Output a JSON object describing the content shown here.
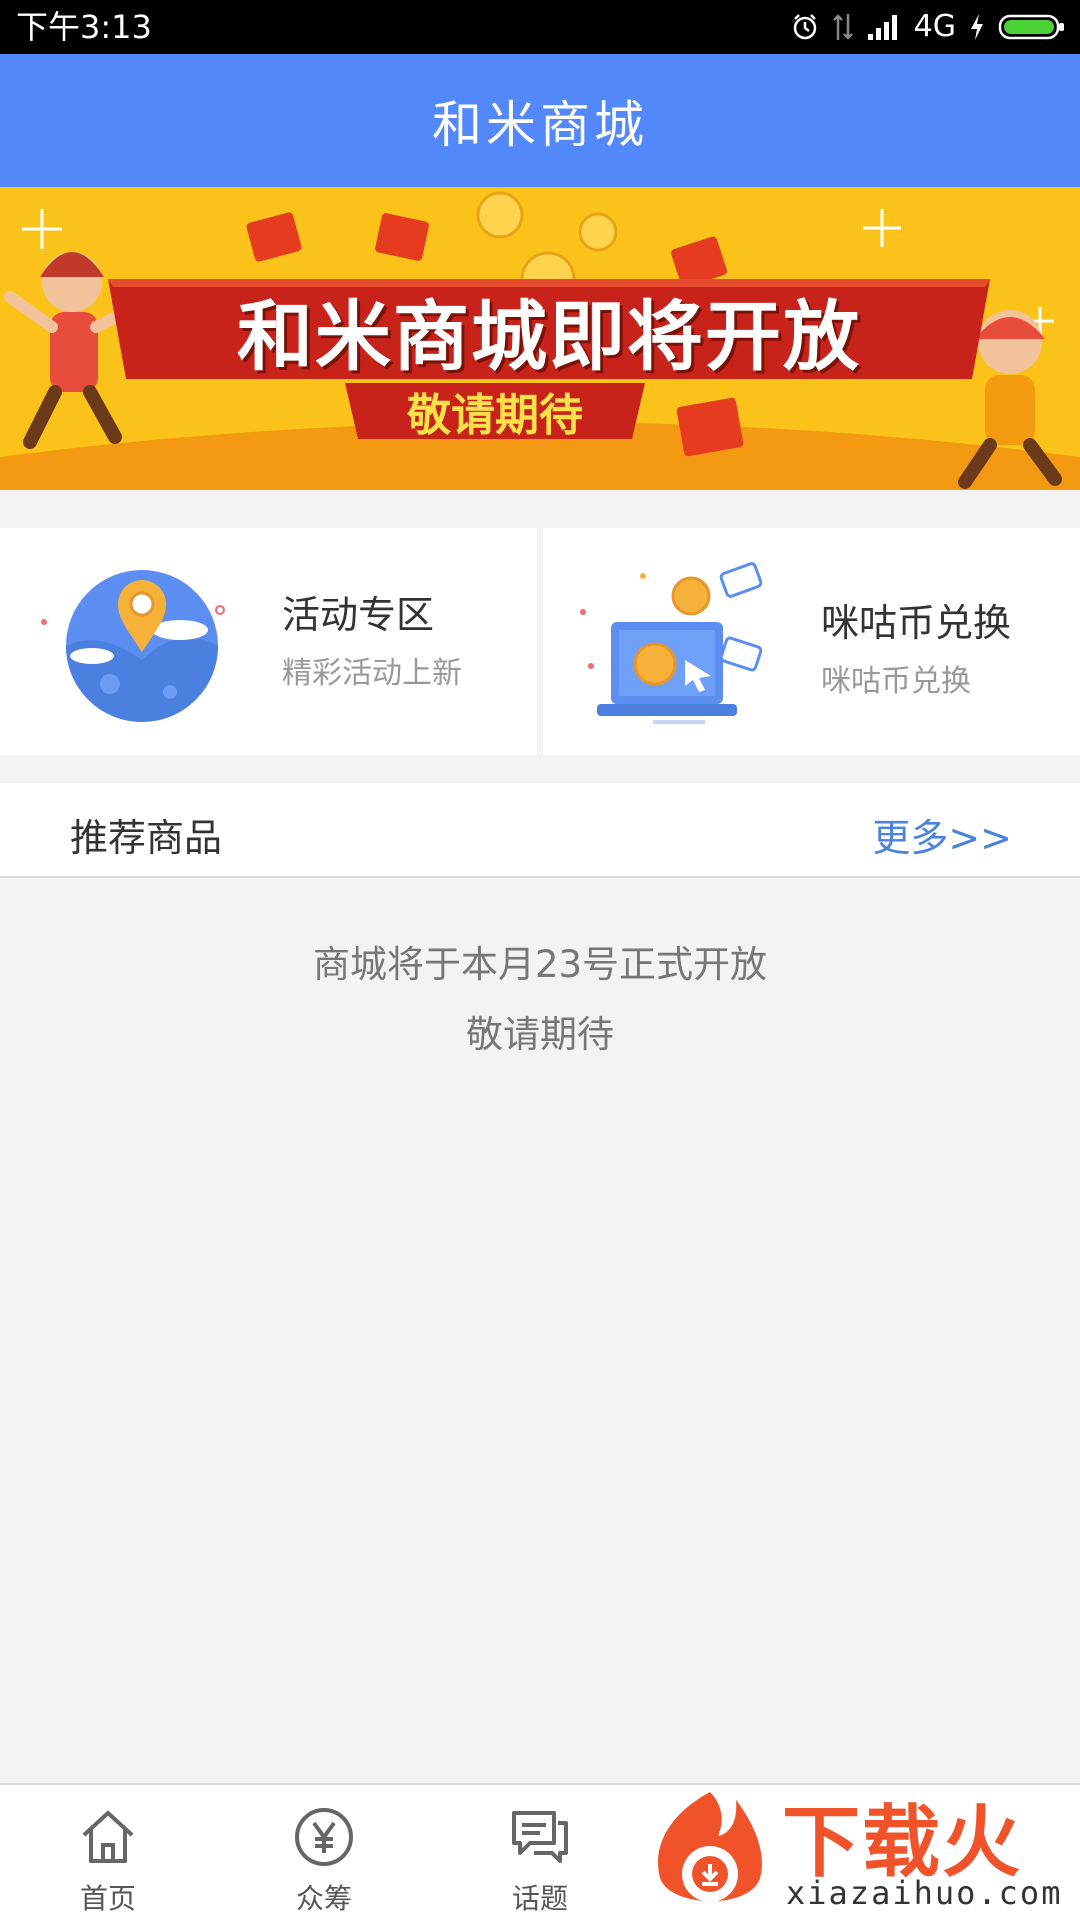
{
  "status_bar": {
    "time": "下午3:13",
    "network": "4G",
    "icons": [
      "alarm-icon",
      "data-arrows-icon",
      "signal-icon",
      "charging-icon",
      "battery-icon"
    ]
  },
  "header": {
    "title": "和米商城"
  },
  "banner": {
    "headline": "和米商城即将开放",
    "subline": "敬请期待"
  },
  "features": [
    {
      "title": "活动专区",
      "subtitle": "精彩活动上新",
      "icon": "location-pin-globe-icon"
    },
    {
      "title": "咪咕币兑换",
      "subtitle": "咪咕币兑换",
      "icon": "coin-exchange-icon"
    }
  ],
  "recommend": {
    "title": "推荐商品",
    "more": "更多>>"
  },
  "notice": {
    "line1": "商城将于本月23号正式开放",
    "line2": "敬请期待"
  },
  "bottom_nav": [
    {
      "label": "首页",
      "icon": "home-icon"
    },
    {
      "label": "众筹",
      "icon": "yuan-circle-icon"
    },
    {
      "label": "话题",
      "icon": "chat-bubbles-icon"
    }
  ],
  "watermark": {
    "brand": "下载火",
    "url": "xiazaihuo.com"
  },
  "colors": {
    "accent": "#5388fb",
    "banner": "#fbc31a",
    "link": "#4a82e0",
    "watermark": "#f0532a"
  }
}
